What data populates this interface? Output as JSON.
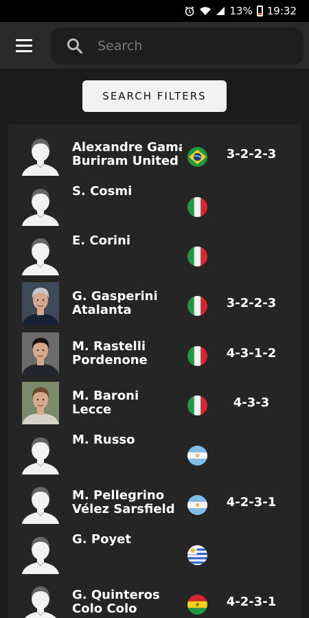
{
  "status_bar": {
    "battery": "13%",
    "time": "19:32",
    "icons": [
      "alarm-icon",
      "wifi-icon",
      "signal-icon",
      "battery-icon"
    ]
  },
  "app_bar": {
    "menu_icon": "hamburger-menu-icon",
    "search": {
      "placeholder": "Search",
      "icon": "search-icon"
    }
  },
  "filters_button": {
    "label": "SEARCH FILTERS"
  },
  "coaches": [
    {
      "name": "Alexandre Gama",
      "team": "Buriram United",
      "flag": "brazil",
      "formation": "3-2-2-3",
      "photo": "placeholder"
    },
    {
      "name": "S. Cosmi",
      "team": "",
      "flag": "italy",
      "formation": "",
      "photo": "placeholder"
    },
    {
      "name": "E. Corini",
      "team": "",
      "flag": "italy",
      "formation": "",
      "photo": "placeholder"
    },
    {
      "name": "G. Gasperini",
      "team": "Atalanta",
      "flag": "italy",
      "formation": "3-2-2-3",
      "photo": "gasperini"
    },
    {
      "name": "M. Rastelli",
      "team": "Pordenone",
      "flag": "italy",
      "formation": "4-3-1-2",
      "photo": "rastelli"
    },
    {
      "name": "M. Baroni",
      "team": "Lecce",
      "flag": "italy",
      "formation": "4-3-3",
      "photo": "baroni"
    },
    {
      "name": "M. Russo",
      "team": "",
      "flag": "argentina",
      "formation": "",
      "photo": "placeholder"
    },
    {
      "name": "M. Pellegrino",
      "team": "Vélez Sarsfield",
      "flag": "argentina",
      "formation": "4-2-3-1",
      "photo": "placeholder"
    },
    {
      "name": "G. Poyet",
      "team": "",
      "flag": "uruguay",
      "formation": "",
      "photo": "placeholder"
    },
    {
      "name": "G. Quinteros",
      "team": "Colo Colo",
      "flag": "bolivia",
      "formation": "4-2-3-1",
      "photo": "placeholder"
    }
  ]
}
